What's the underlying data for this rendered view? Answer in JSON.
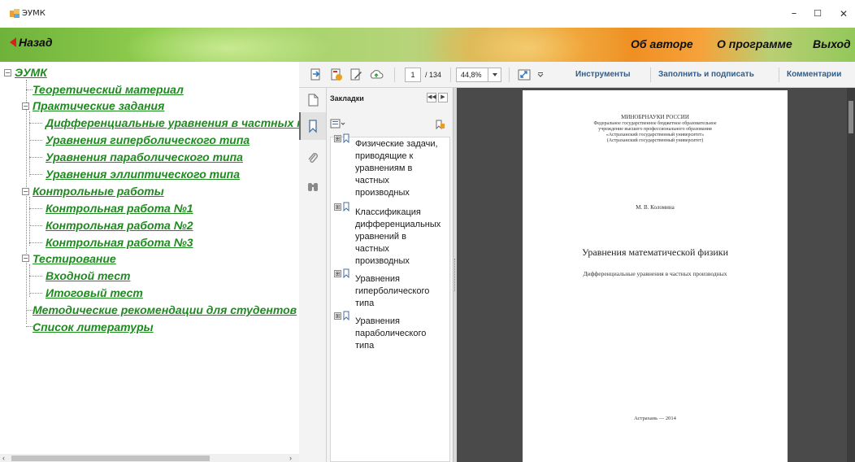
{
  "window": {
    "title": "ЭУМК",
    "minimize": "–",
    "maximize": "☐",
    "close": "✕"
  },
  "banner": {
    "back": "Назад",
    "about_author": "Об авторе",
    "about_program": "О программе",
    "exit": "Выход"
  },
  "tree": {
    "root": "ЭУМК",
    "items": [
      "Теоретический материал",
      "Практические задания",
      "Дифференциальные уравнения в частных производных",
      "Уравнения гиперболического типа",
      "Уравнения параболического типа",
      "Уравнения эллиптического типа",
      "Контрольные работы",
      "Контрольная работа №1",
      "Контрольная работа №2",
      "Контрольная работа №3",
      "Тестирование",
      "Входной тест",
      "Итоговый тест",
      "Методические рекомендации для студентов",
      "Список литературы"
    ],
    "scroll_left": "‹",
    "scroll_right": "›"
  },
  "toolbar": {
    "page_current": "1",
    "page_total": "/ 134",
    "zoom": "44,8%",
    "tools": "Инструменты",
    "fill_sign": "Заполнить и подписать",
    "comments": "Комментарии"
  },
  "bookmarks": {
    "title": "Закладки",
    "collapse": "◀◀",
    "next": "▶",
    "toggle": "⊞",
    "items": [
      [
        "Физические задачи,",
        "приводящие к",
        "уравнениям в",
        "частных",
        "производных"
      ],
      [
        "Классификация",
        "дифференциальных",
        "уравнений в",
        "частных",
        "производных"
      ],
      [
        "Уравнения",
        "гиперболического",
        "типа"
      ],
      [
        "Уравнения",
        "параболического",
        "типа"
      ]
    ]
  },
  "document": {
    "ministry": "МИНОБРНАУКИ РОССИИ",
    "inst1": "Федеральное государственное бюджетное образовательное",
    "inst2": "учреждение высшего профессионального образования",
    "inst3": "«Астраханский государственный университет»",
    "inst4": "(Астраханский государственный университет)",
    "author": "М. В. Коломина",
    "title": "Уравнения математической физики",
    "subtitle": "Дифференциальные уравнения в частных производных",
    "footer": "Астрахань — 2014"
  },
  "colors": {
    "tree_link": "#1f8a1f",
    "toolbar_text": "#2f5e8e",
    "back_arrow": "#d62020"
  }
}
